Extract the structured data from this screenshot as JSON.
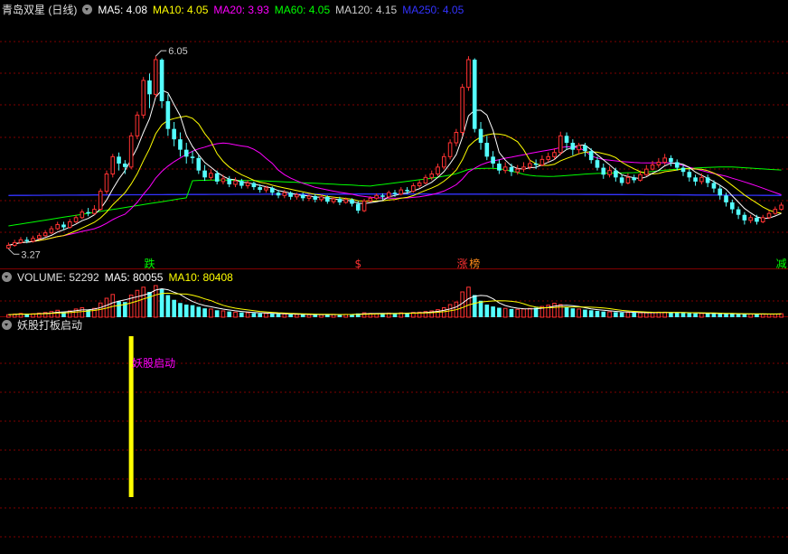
{
  "header": {
    "title": "青岛双星 (日线)",
    "ma": [
      {
        "label": "MA5: 4.08",
        "color": "#ffffff"
      },
      {
        "label": "MA10: 4.05",
        "color": "#ffff00"
      },
      {
        "label": "MA20: 3.93",
        "color": "#ff00ff"
      },
      {
        "label": "MA60: 4.05",
        "color": "#00ff00"
      },
      {
        "label": "MA120: 4.15",
        "color": "#cccccc"
      },
      {
        "label": "MA250: 4.05",
        "color": "#3333ff"
      }
    ]
  },
  "volume_header": {
    "label": "VOLUME: 52292",
    "ma5": "MA5: 80055",
    "ma10": "MA10: 80408"
  },
  "indicator_header": {
    "label": "妖股打板启动"
  },
  "colors": {
    "up": "#ff3232",
    "down": "#54ffff",
    "ma5": "#ffffff",
    "ma10": "#ffff00",
    "ma20": "#ff00ff",
    "ma60": "#00ff00",
    "ma250": "#3333ff",
    "grid": "#800000",
    "signal": "#ffff00",
    "signal_text": "#ff00ff"
  },
  "chart_data": {
    "type": "candlestick",
    "annotations": {
      "high": "6.05",
      "low": "3.27"
    },
    "markers": [
      {
        "text": "跌",
        "index": 23,
        "color": "#00ff00"
      },
      {
        "text": "$",
        "index": 57,
        "color": "#ff3232"
      },
      {
        "text": "涨",
        "index": 74,
        "color": "#ff3232"
      },
      {
        "text": "榜",
        "index": 76,
        "color": "#ff8c1a"
      },
      {
        "text": "减",
        "index": 126,
        "color": "#00ff00"
      }
    ],
    "signal": {
      "label": "妖股启动",
      "index": 20,
      "value": 1
    },
    "candles": [
      [
        3.28,
        3.32,
        3.36,
        3.27
      ],
      [
        3.32,
        3.36,
        3.4,
        3.3
      ],
      [
        3.36,
        3.4,
        3.44,
        3.34
      ],
      [
        3.4,
        3.38,
        3.44,
        3.35
      ],
      [
        3.38,
        3.42,
        3.46,
        3.36
      ],
      [
        3.42,
        3.46,
        3.5,
        3.4
      ],
      [
        3.46,
        3.5,
        3.54,
        3.44
      ],
      [
        3.5,
        3.56,
        3.6,
        3.48
      ],
      [
        3.56,
        3.62,
        3.66,
        3.54
      ],
      [
        3.62,
        3.58,
        3.66,
        3.54
      ],
      [
        3.58,
        3.66,
        3.7,
        3.56
      ],
      [
        3.66,
        3.72,
        3.76,
        3.64
      ],
      [
        3.72,
        3.8,
        3.84,
        3.7
      ],
      [
        3.8,
        3.78,
        3.86,
        3.74
      ],
      [
        3.78,
        3.84,
        3.9,
        3.76
      ],
      [
        3.84,
        4.1,
        4.14,
        3.82
      ],
      [
        4.1,
        4.35,
        4.4,
        4.06
      ],
      [
        4.35,
        4.6,
        4.64,
        4.3
      ],
      [
        4.6,
        4.5,
        4.66,
        4.4
      ],
      [
        4.5,
        4.45,
        4.55,
        4.35
      ],
      [
        4.45,
        4.9,
        4.95,
        4.42
      ],
      [
        4.9,
        5.2,
        5.25,
        4.85
      ],
      [
        5.2,
        5.7,
        5.75,
        5.15
      ],
      [
        5.7,
        5.5,
        5.8,
        5.3
      ],
      [
        5.5,
        6.0,
        6.05,
        5.45
      ],
      [
        6.0,
        5.4,
        6.02,
        5.3
      ],
      [
        5.4,
        5.0,
        5.5,
        4.9
      ],
      [
        5.0,
        4.85,
        5.1,
        4.75
      ],
      [
        4.85,
        4.7,
        4.95,
        4.6
      ],
      [
        4.7,
        4.6,
        4.8,
        4.5
      ],
      [
        4.6,
        4.58,
        4.68,
        4.5
      ],
      [
        4.58,
        4.4,
        4.62,
        4.35
      ],
      [
        4.4,
        4.3,
        4.48,
        4.25
      ],
      [
        4.3,
        4.36,
        4.42,
        4.26
      ],
      [
        4.36,
        4.24,
        4.4,
        4.2
      ],
      [
        4.24,
        4.28,
        4.34,
        4.2
      ],
      [
        4.28,
        4.2,
        4.32,
        4.16
      ],
      [
        4.2,
        4.25,
        4.3,
        4.16
      ],
      [
        4.25,
        4.18,
        4.28,
        4.14
      ],
      [
        4.18,
        4.22,
        4.26,
        4.14
      ],
      [
        4.22,
        4.16,
        4.24,
        4.12
      ],
      [
        4.16,
        4.12,
        4.2,
        4.08
      ],
      [
        4.12,
        4.15,
        4.18,
        4.08
      ],
      [
        4.15,
        4.08,
        4.17,
        4.04
      ],
      [
        4.08,
        4.04,
        4.12,
        4.0
      ],
      [
        4.04,
        4.08,
        4.12,
        4.0
      ],
      [
        4.08,
        4.02,
        4.1,
        3.98
      ],
      [
        4.02,
        4.05,
        4.08,
        3.98
      ],
      [
        4.05,
        4.0,
        4.08,
        3.96
      ],
      [
        4.0,
        4.03,
        4.06,
        3.96
      ],
      [
        4.03,
        3.98,
        4.06,
        3.94
      ],
      [
        3.98,
        4.02,
        4.05,
        3.95
      ],
      [
        4.02,
        3.95,
        4.04,
        3.92
      ],
      [
        3.95,
        3.99,
        4.02,
        3.92
      ],
      [
        3.99,
        3.94,
        4.02,
        3.9
      ],
      [
        3.94,
        3.98,
        4.01,
        3.92
      ],
      [
        3.98,
        3.92,
        4.0,
        3.88
      ],
      [
        3.92,
        3.82,
        3.96,
        3.78
      ],
      [
        3.82,
        3.96,
        3.99,
        3.8
      ],
      [
        3.96,
        4.0,
        4.03,
        3.94
      ],
      [
        4.0,
        4.04,
        4.07,
        3.98
      ],
      [
        4.04,
        4.02,
        4.07,
        3.98
      ],
      [
        4.02,
        4.08,
        4.11,
        4.0
      ],
      [
        4.08,
        4.06,
        4.12,
        4.02
      ],
      [
        4.06,
        4.12,
        4.16,
        4.04
      ],
      [
        4.12,
        4.1,
        4.16,
        4.06
      ],
      [
        4.1,
        4.18,
        4.22,
        4.08
      ],
      [
        4.18,
        4.22,
        4.26,
        4.15
      ],
      [
        4.22,
        4.3,
        4.34,
        4.2
      ],
      [
        4.3,
        4.35,
        4.4,
        4.26
      ],
      [
        4.35,
        4.45,
        4.5,
        4.32
      ],
      [
        4.45,
        4.6,
        4.65,
        4.42
      ],
      [
        4.6,
        4.8,
        4.85,
        4.56
      ],
      [
        4.8,
        4.95,
        5.0,
        4.75
      ],
      [
        4.95,
        5.6,
        5.65,
        4.9
      ],
      [
        5.6,
        6.0,
        6.05,
        5.55
      ],
      [
        6.0,
        5.0,
        6.02,
        4.95
      ],
      [
        5.0,
        4.8,
        5.1,
        4.7
      ],
      [
        4.8,
        4.6,
        4.9,
        4.55
      ],
      [
        4.6,
        4.5,
        4.68,
        4.44
      ],
      [
        4.5,
        4.4,
        4.56,
        4.35
      ],
      [
        4.4,
        4.45,
        4.52,
        4.36
      ],
      [
        4.45,
        4.38,
        4.5,
        4.32
      ],
      [
        4.38,
        4.42,
        4.48,
        4.34
      ],
      [
        4.42,
        4.45,
        4.52,
        4.38
      ],
      [
        4.45,
        4.5,
        4.56,
        4.42
      ],
      [
        4.5,
        4.48,
        4.56,
        4.42
      ],
      [
        4.48,
        4.56,
        4.62,
        4.46
      ],
      [
        4.56,
        4.6,
        4.66,
        4.52
      ],
      [
        4.6,
        4.66,
        4.72,
        4.56
      ],
      [
        4.66,
        4.9,
        4.96,
        4.62
      ],
      [
        4.9,
        4.8,
        4.95,
        4.7
      ],
      [
        4.8,
        4.7,
        4.85,
        4.62
      ],
      [
        4.7,
        4.76,
        4.8,
        4.64
      ],
      [
        4.76,
        4.68,
        4.8,
        4.6
      ],
      [
        4.68,
        4.55,
        4.72,
        4.5
      ],
      [
        4.55,
        4.44,
        4.6,
        4.4
      ],
      [
        4.44,
        4.34,
        4.5,
        4.28
      ],
      [
        4.34,
        4.4,
        4.46,
        4.3
      ],
      [
        4.4,
        4.3,
        4.44,
        4.24
      ],
      [
        4.3,
        4.22,
        4.34,
        4.18
      ],
      [
        4.22,
        4.3,
        4.36,
        4.2
      ],
      [
        4.3,
        4.26,
        4.34,
        4.22
      ],
      [
        4.26,
        4.34,
        4.4,
        4.24
      ],
      [
        4.34,
        4.42,
        4.48,
        4.32
      ],
      [
        4.42,
        4.48,
        4.54,
        4.4
      ],
      [
        4.48,
        4.52,
        4.58,
        4.44
      ],
      [
        4.52,
        4.58,
        4.64,
        4.48
      ],
      [
        4.58,
        4.52,
        4.62,
        4.46
      ],
      [
        4.52,
        4.44,
        4.56,
        4.4
      ],
      [
        4.44,
        4.38,
        4.48,
        4.32
      ],
      [
        4.38,
        4.3,
        4.42,
        4.24
      ],
      [
        4.3,
        4.24,
        4.34,
        4.18
      ],
      [
        4.24,
        4.3,
        4.36,
        4.2
      ],
      [
        4.3,
        4.22,
        4.34,
        4.16
      ],
      [
        4.22,
        4.14,
        4.26,
        4.08
      ],
      [
        4.14,
        4.04,
        4.18,
        3.98
      ],
      [
        4.04,
        3.94,
        4.08,
        3.88
      ],
      [
        3.94,
        3.84,
        3.98,
        3.78
      ],
      [
        3.84,
        3.76,
        3.88,
        3.7
      ],
      [
        3.76,
        3.68,
        3.8,
        3.62
      ],
      [
        3.68,
        3.72,
        3.76,
        3.64
      ],
      [
        3.72,
        3.66,
        3.76,
        3.62
      ],
      [
        3.66,
        3.72,
        3.76,
        3.64
      ],
      [
        3.72,
        3.78,
        3.82,
        3.7
      ],
      [
        3.78,
        3.84,
        3.88,
        3.76
      ],
      [
        3.84,
        3.9,
        3.94,
        3.82
      ]
    ],
    "volume": [
      8,
      10,
      12,
      9,
      11,
      13,
      15,
      18,
      22,
      17,
      20,
      26,
      30,
      24,
      28,
      45,
      60,
      72,
      50,
      48,
      70,
      85,
      95,
      80,
      100,
      90,
      70,
      55,
      45,
      40,
      38,
      33,
      28,
      26,
      22,
      20,
      18,
      16,
      15,
      14,
      13,
      12,
      12,
      11,
      10,
      10,
      9,
      9,
      9,
      8,
      8,
      8,
      9,
      9,
      8,
      9,
      10,
      12,
      14,
      12,
      11,
      12,
      13,
      12,
      14,
      13,
      15,
      16,
      18,
      20,
      24,
      30,
      40,
      48,
      80,
      95,
      70,
      52,
      40,
      34,
      30,
      28,
      26,
      25,
      26,
      28,
      30,
      34,
      38,
      44,
      40,
      32,
      28,
      26,
      24,
      22,
      20,
      18,
      17,
      16,
      15,
      15,
      14,
      14,
      14,
      15,
      16,
      16,
      15,
      14,
      13,
      13,
      12,
      12,
      12,
      11,
      11,
      11,
      10,
      10,
      10,
      10,
      10,
      10,
      10,
      10,
      11
    ]
  }
}
